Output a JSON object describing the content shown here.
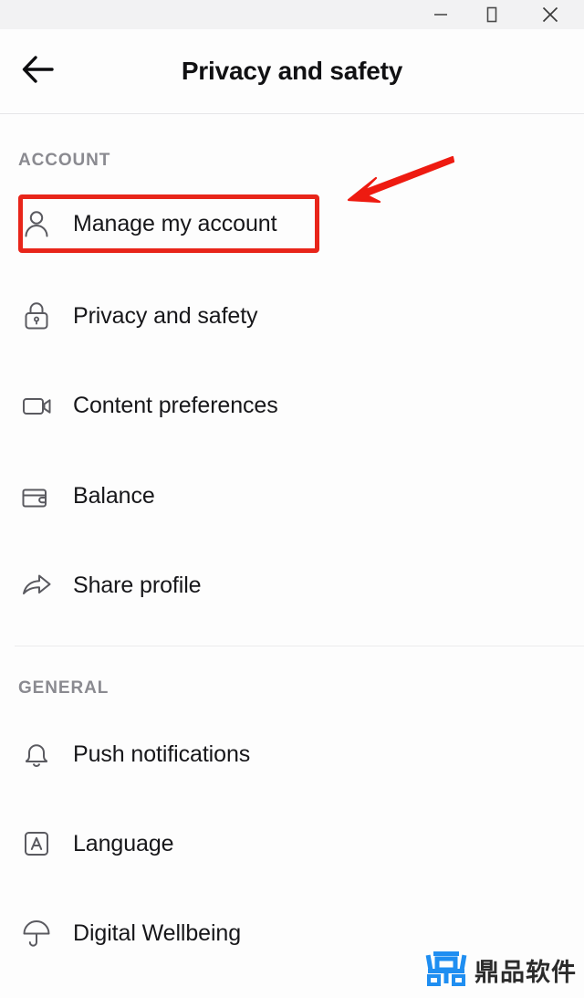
{
  "window": {
    "controls": [
      {
        "name": "minimize",
        "icon": "minimize-icon",
        "label": "–"
      },
      {
        "name": "maximize",
        "icon": "maximize-icon",
        "label": "□"
      },
      {
        "name": "close",
        "icon": "close-icon",
        "label": "✕"
      }
    ]
  },
  "header": {
    "back_icon": "back-arrow-icon",
    "title": "Privacy and safety"
  },
  "sections": [
    {
      "label": "ACCOUNT",
      "items": [
        {
          "label": "Manage my account",
          "icon": "person-icon",
          "highlighted": true
        },
        {
          "label": "Privacy and safety",
          "icon": "lock-icon",
          "highlighted": false
        },
        {
          "label": "Content preferences",
          "icon": "video-camera-icon",
          "highlighted": false
        },
        {
          "label": "Balance",
          "icon": "wallet-icon",
          "highlighted": false
        },
        {
          "label": "Share profile",
          "icon": "share-arrow-icon",
          "highlighted": false
        }
      ]
    },
    {
      "label": "GENERAL",
      "items": [
        {
          "label": "Push notifications",
          "icon": "bell-icon",
          "highlighted": false
        },
        {
          "label": "Language",
          "icon": "letter-a-box-icon",
          "highlighted": false
        },
        {
          "label": "Digital Wellbeing",
          "icon": "umbrella-icon",
          "highlighted": false
        }
      ]
    }
  ],
  "annotation": {
    "highlight_color": "#e8251a",
    "arrow_color": "#ee1b11",
    "target": "Manage my account"
  },
  "watermark": {
    "text": "鼎品软件",
    "logo_color": "#1f8ef1",
    "logo_icon": "ding-logo-icon"
  },
  "colors": {
    "background": "#fdfdfd",
    "titlebar": "#f2f2f3",
    "text_primary": "#17171a",
    "text_section": "#8a8a90",
    "icon_stroke": "#5a5a60",
    "divider": "#ececed"
  }
}
